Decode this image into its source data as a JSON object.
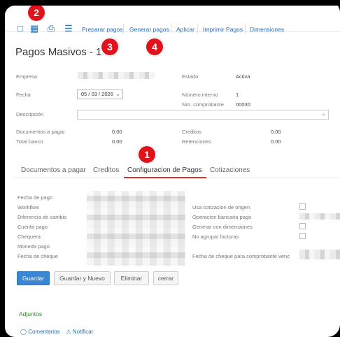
{
  "toolbar": {
    "links": [
      "Preparar pagos",
      "Generar pagos",
      "Aplicar",
      "Imprimir Pagos",
      "Dimensiones"
    ],
    "icons": [
      "new-icon",
      "save-icon",
      "print-icon",
      "attach-icon"
    ]
  },
  "badges": [
    "1",
    "2",
    "3",
    "4"
  ],
  "page_title": "Pagos Masivos - 1",
  "form": {
    "empresa_label": "Empresa",
    "estado_label": "Estado",
    "estado_value": "Activa",
    "fecha_label": "Fecha",
    "fecha_value": "05 / 03 / 2026",
    "numero_interno_label": "Número interno",
    "numero_interno_value": "1",
    "nro_comprobante_label": "Nro. comprobante",
    "nro_comprobante_value": "00030",
    "descripcion_label": "Descripción",
    "documentos_label": "Documentos a pagar",
    "documentos_value": "0.00",
    "creditos_label": "Creditos",
    "creditos_value": "0.00",
    "total_banco_label": "Total banco",
    "total_banco_value": "0.00",
    "retenciones_label": "Retenciones",
    "retenciones_value": "0.00"
  },
  "tabs": [
    "Documentos a pagar",
    "Creditos",
    "Configuracion de Pagos",
    "Cotizaciones"
  ],
  "config": {
    "left_labels": [
      "Fecha de pago",
      "Workflow",
      "Diferencia de cambio",
      "Cuenta pago",
      "Chequera",
      "Moneda pago",
      "Fecha de cheque"
    ],
    "right_labels": [
      "Usa cotizacion de origen",
      "Operacion bancaria pago",
      "Generar con dimensiones",
      "No agrupar facturas"
    ],
    "fecha_cheque_comprobante_label": "Fecha de cheque para comprobante venc"
  },
  "buttons": [
    "Guardar",
    "Guardar y Nuevo",
    "Eliminar",
    "cerrar"
  ],
  "adjuntos": "Adjuntos",
  "bottom_links": [
    "Comentarios",
    "Notificar"
  ]
}
